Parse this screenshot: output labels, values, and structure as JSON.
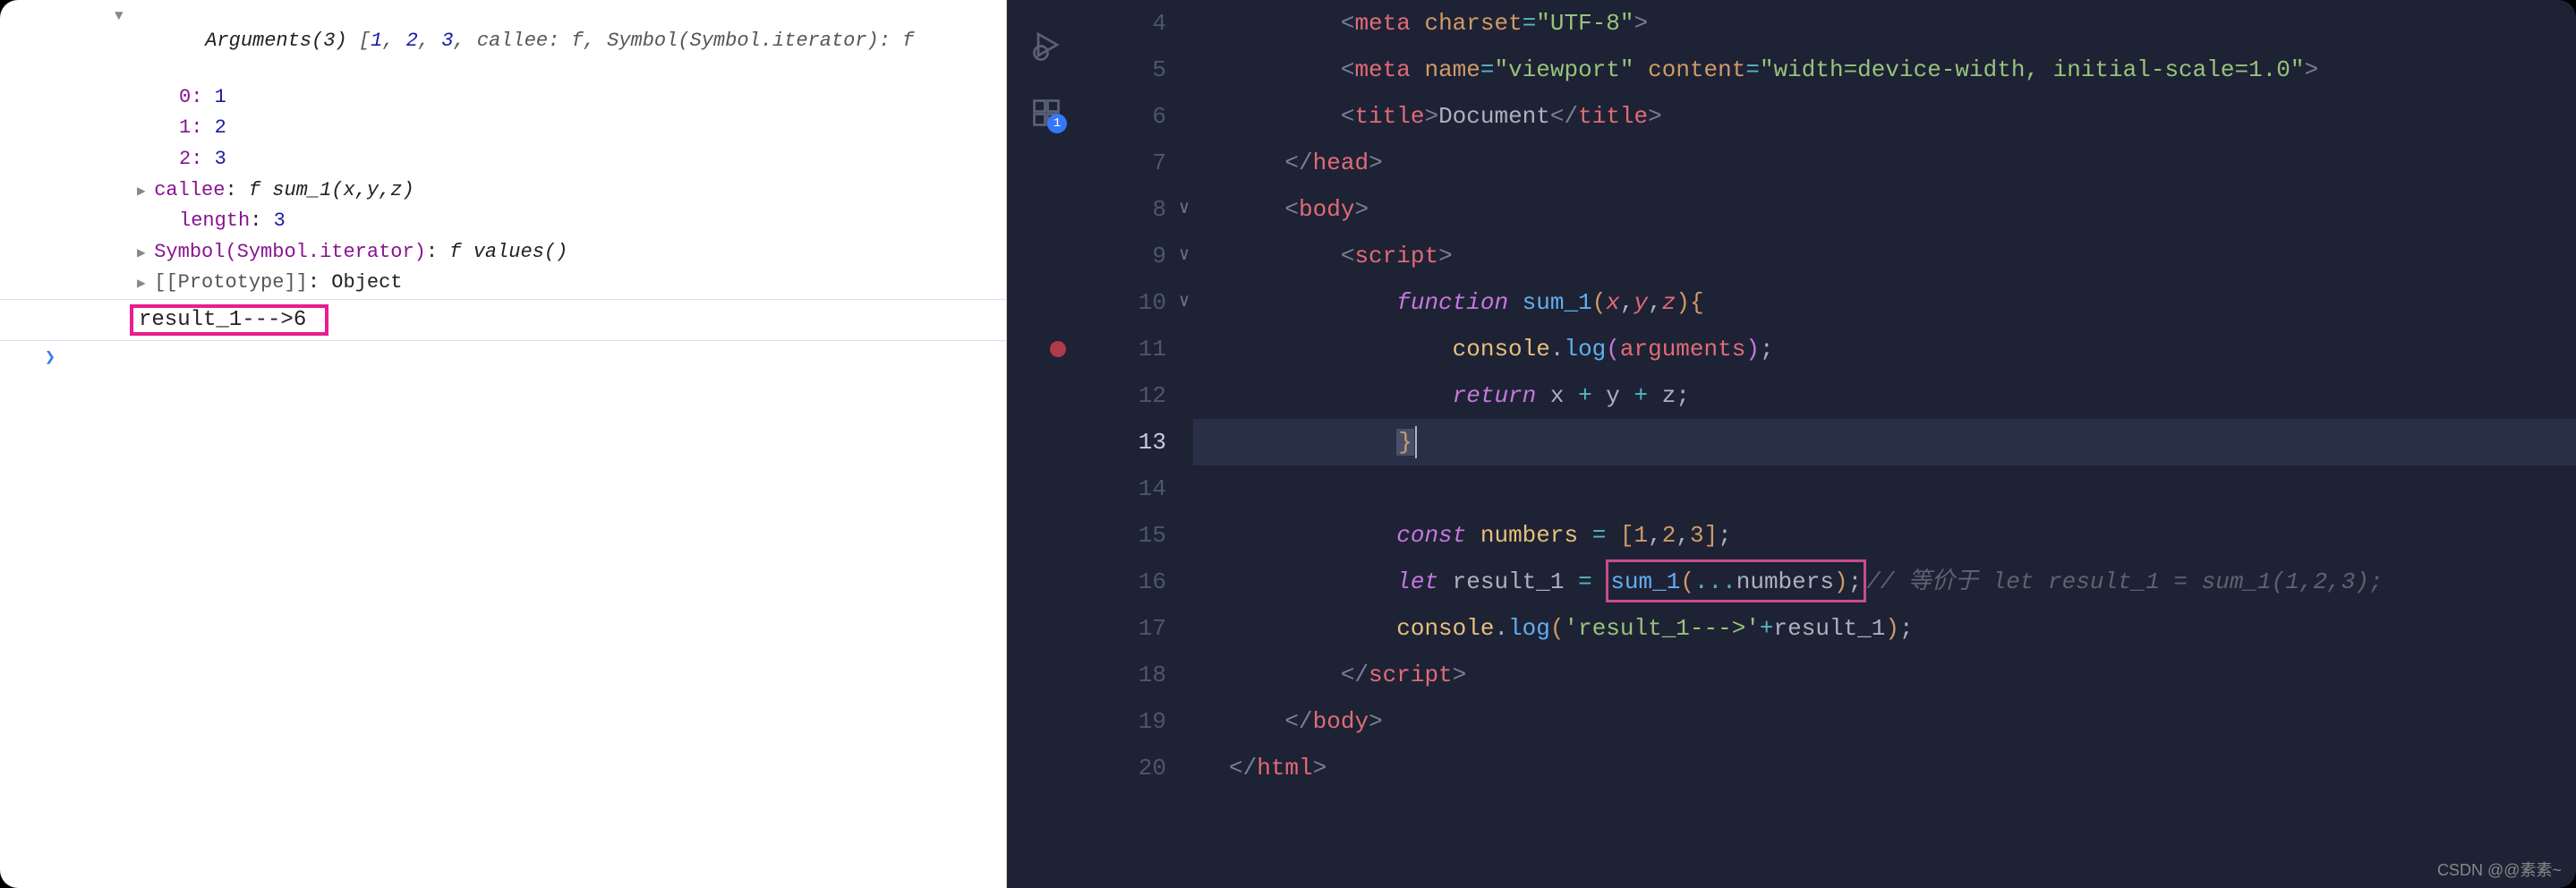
{
  "console": {
    "arguments_header_pre": "Arguments(3) ",
    "arguments_header_arr": "[1, 2, 3, callee: f, Symbol(Symbol.iterator): f",
    "entries": [
      {
        "key": "0",
        "val": "1"
      },
      {
        "key": "1",
        "val": "2"
      },
      {
        "key": "2",
        "val": "3"
      }
    ],
    "callee_label": "callee",
    "callee_val": "f sum_1(x,y,z)",
    "length_label": "length",
    "length_val": "3",
    "symbol_label": "Symbol(Symbol.iterator)",
    "symbol_val": "f values()",
    "proto_label": "[[Prototype]]",
    "proto_val": "Object",
    "result_text": "result_1--->6"
  },
  "activity_badge": "1",
  "gutter": {
    "lines": [
      "4",
      "5",
      "6",
      "7",
      "8",
      "9",
      "10",
      "11",
      "12",
      "13",
      "14",
      "15",
      "16",
      "17",
      "18",
      "19",
      "20"
    ],
    "active": "13",
    "folds": {
      "8": "∨",
      "9": "∨",
      "10": "∨"
    },
    "breakpoint": "11"
  },
  "code": {
    "l4": {
      "indent": "        ",
      "tag": "meta",
      "attr": "charset",
      "val": "\"UTF-8\""
    },
    "l5": {
      "indent": "        ",
      "tag": "meta",
      "attr1": "name",
      "val1": "\"viewport\"",
      "attr2": "content",
      "val2": "\"width=device-width, initial-scale=1.0\""
    },
    "l6": {
      "indent": "        ",
      "open": "title",
      "text": "Document",
      "close": "title"
    },
    "l7": {
      "indent": "    ",
      "close": "head"
    },
    "l8": {
      "indent": "    ",
      "open": "body"
    },
    "l9": {
      "indent": "        ",
      "open": "script"
    },
    "l10": {
      "indent": "            ",
      "kw": "function",
      "fn": "sum_1",
      "params": "x,y,z"
    },
    "l11": {
      "indent": "                ",
      "obj": "console",
      "method": "log",
      "arg": "arguments"
    },
    "l12": {
      "indent": "                ",
      "kw": "return",
      "expr_a": "x",
      "expr_b": "y",
      "expr_c": "z"
    },
    "l13": {
      "indent": "            "
    },
    "l15": {
      "indent": "            ",
      "kw": "const",
      "name": "numbers",
      "vals": [
        "1",
        "2",
        "3"
      ]
    },
    "l16": {
      "indent": "            ",
      "kw": "let",
      "name": "result_1",
      "fn": "sum_1",
      "spread": "numbers",
      "comment": "// 等价于 let result_1 = sum_1(1,2,3);"
    },
    "l17": {
      "indent": "            ",
      "obj": "console",
      "method": "log",
      "str": "'result_1--->'",
      "plus": "result_1"
    },
    "l18": {
      "indent": "        ",
      "close": "script"
    },
    "l19": {
      "indent": "    ",
      "close": "body"
    },
    "l20": {
      "indent": "",
      "close": "html"
    }
  },
  "watermark": "CSDN @@素素~"
}
